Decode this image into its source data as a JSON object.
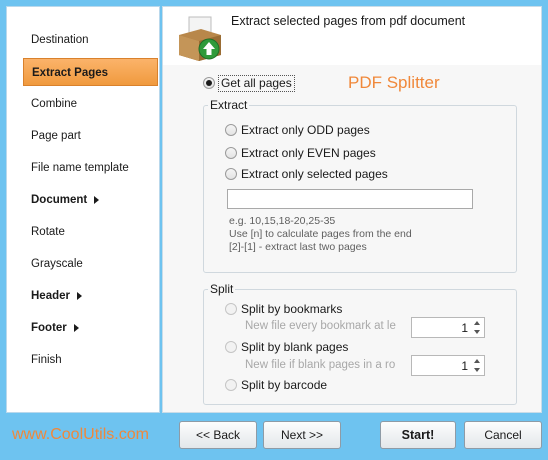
{
  "sidebar": {
    "items": [
      {
        "label": "Destination",
        "active": false,
        "bold": false,
        "arrow": false
      },
      {
        "label": "Extract Pages",
        "active": true,
        "bold": true,
        "arrow": false
      },
      {
        "label": "Combine",
        "active": false,
        "bold": false,
        "arrow": false
      },
      {
        "label": "Page part",
        "active": false,
        "bold": false,
        "arrow": false
      },
      {
        "label": "File name template",
        "active": false,
        "bold": false,
        "arrow": false
      },
      {
        "label": "Document",
        "active": false,
        "bold": true,
        "arrow": true
      },
      {
        "label": "Rotate",
        "active": false,
        "bold": false,
        "arrow": false
      },
      {
        "label": "Grayscale",
        "active": false,
        "bold": false,
        "arrow": false
      },
      {
        "label": "Header",
        "active": false,
        "bold": true,
        "arrow": true
      },
      {
        "label": "Footer",
        "active": false,
        "bold": true,
        "arrow": true
      },
      {
        "label": "Finish",
        "active": false,
        "bold": false,
        "arrow": false
      }
    ]
  },
  "header": {
    "title": "Extract selected pages from pdf document",
    "icon": "box-with-green-arrow-icon"
  },
  "main": {
    "get_all_label": "Get all pages",
    "get_all_checked": true,
    "brand": "PDF Splitter",
    "extract": {
      "title": "Extract",
      "options": [
        "Extract only ODD pages",
        "Extract only EVEN pages",
        "Extract only selected pages"
      ],
      "selected_input_value": "",
      "hints": [
        "e.g. 10,15,18-20,25-35",
        "Use [n] to calculate pages from the end",
        "[2]-[1] - extract last two pages"
      ]
    },
    "split": {
      "title": "Split",
      "bookmarks_label": "Split by bookmarks",
      "bookmarks_sub": "New file every bookmark at le",
      "bookmarks_value": "1",
      "blank_label": "Split by blank pages",
      "blank_sub": "New file if blank pages in a ro",
      "blank_value": "1",
      "barcode_label": "Split by barcode"
    }
  },
  "footer": {
    "url": "www.CoolUtils.com",
    "back_label": "<< Back",
    "next_label": "Next >>",
    "start_label": "Start!",
    "cancel_label": "Cancel"
  },
  "colors": {
    "accent_orange": "#f0883a",
    "window_frame": "#6ec3f0",
    "active_item": "#f5a24e"
  }
}
